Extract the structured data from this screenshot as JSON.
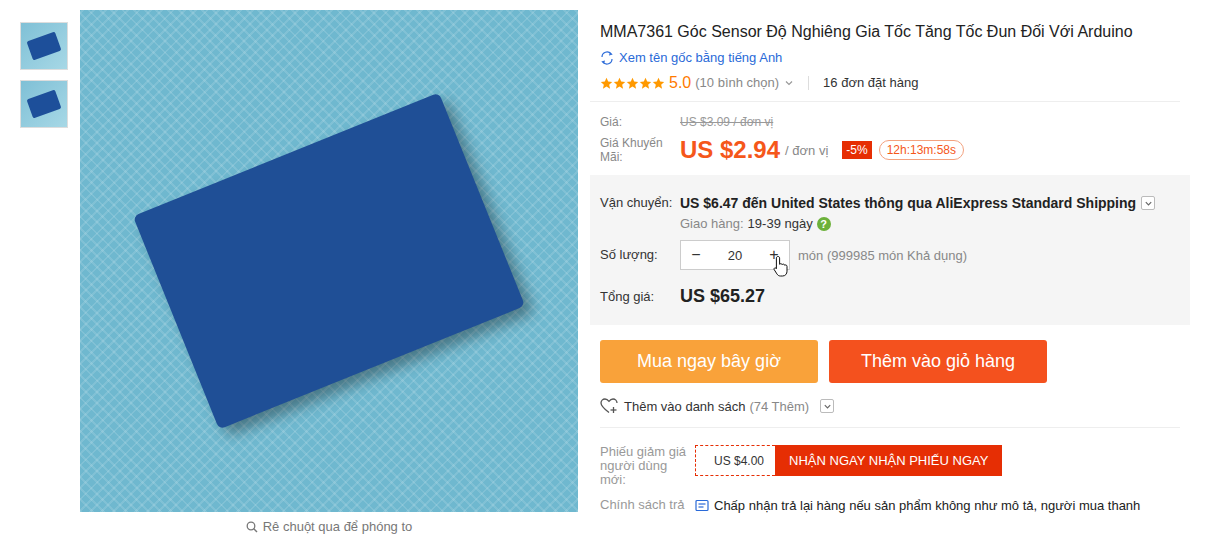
{
  "gallery": {
    "thumbnails": [
      {
        "selected": false
      },
      {
        "selected": false
      }
    ],
    "zoom_hint": "Rê chuột qua để phóng to"
  },
  "product": {
    "title": "MMA7361 Góc Sensor Độ Nghiêng Gia Tốc Tăng Tốc Đun Đối Với Arduino",
    "translate_link": "Xem tên gốc bằng tiếng Anh"
  },
  "rating": {
    "stars": 5,
    "score": "5.0",
    "votes": "(10 bình chọn)",
    "orders": "16 đơn đặt hàng"
  },
  "price": {
    "label": "Giá:",
    "original": "US $3.09 / đơn vị",
    "promo_label": "Giá Khuyến Mãi:",
    "promo": "US $2.94",
    "unit": "/ đơn vị",
    "discount": "-5%",
    "countdown": "12h:13m:58s"
  },
  "shipping": {
    "label": "Vận chuyển:",
    "text": "US $6.47 đến United States thông qua AliExpress Standard Shipping",
    "delivery_label": "Giao hàng:",
    "delivery": "19-39 ngày",
    "help": "?"
  },
  "quantity": {
    "label": "Số lượng:",
    "minus": "−",
    "value": "20",
    "plus": "+",
    "available": "món (999985 món Khả dụng)"
  },
  "total": {
    "label": "Tổng giá:",
    "value": "US $65.27"
  },
  "buttons": [
    {
      "label": "Mua ngay bây giờ",
      "kind": "buy"
    },
    {
      "label": "Thêm vào giỏ hàng",
      "kind": "cart"
    }
  ],
  "wishlist": {
    "label": "Thêm vào danh sách",
    "count": "(74 Thêm)"
  },
  "coupon": {
    "label": "Phiếu giảm giá người dùng mới:",
    "amount": "US $4.00",
    "action": "NHẬN NGAY NHẬN PHIẾU NGAY"
  },
  "return_policy": {
    "label": "Chính sách trả",
    "text": "Chấp nhận trả lại hàng nếu sản phẩm không như mô tả, người mua thanh"
  }
}
